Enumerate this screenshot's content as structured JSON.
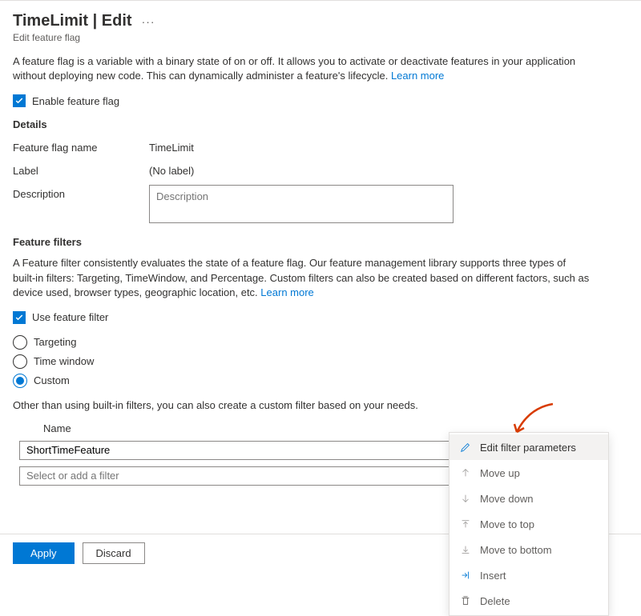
{
  "header": {
    "title": "TimeLimit | Edit",
    "subtitle": "Edit feature flag"
  },
  "intro": {
    "text": "A feature flag is a variable with a binary state of on or off. It allows you to activate or deactivate features in your application without deploying new code. This can dynamically administer a feature's lifecycle.",
    "learn": "Learn more"
  },
  "enable_label": "Enable feature flag",
  "details": {
    "heading": "Details",
    "name_label": "Feature flag name",
    "name_value": "TimeLimit",
    "label_label": "Label",
    "label_value": "(No label)",
    "desc_label": "Description",
    "desc_placeholder": "Description"
  },
  "filters": {
    "heading": "Feature filters",
    "text": "A Feature filter consistently evaluates the state of a feature flag. Our feature management library supports three types of built-in filters: Targeting, TimeWindow, and Percentage. Custom filters can also be created based on different factors, such as device used, browser types, geographic location, etc.",
    "learn": "Learn more",
    "use_label": "Use feature filter",
    "opt_targeting": "Targeting",
    "opt_timewindow": "Time window",
    "opt_custom": "Custom",
    "hint": "Other than using built-in filters, you can also create a custom filter based on your needs.",
    "col_name": "Name",
    "row1_value": "ShortTimeFeature",
    "row2_placeholder": "Select or add a filter"
  },
  "menu": {
    "edit": "Edit filter parameters",
    "up": "Move up",
    "down": "Move down",
    "top": "Move to top",
    "bottom": "Move to bottom",
    "insert": "Insert",
    "delete": "Delete"
  },
  "footer": {
    "apply": "Apply",
    "discard": "Discard"
  }
}
